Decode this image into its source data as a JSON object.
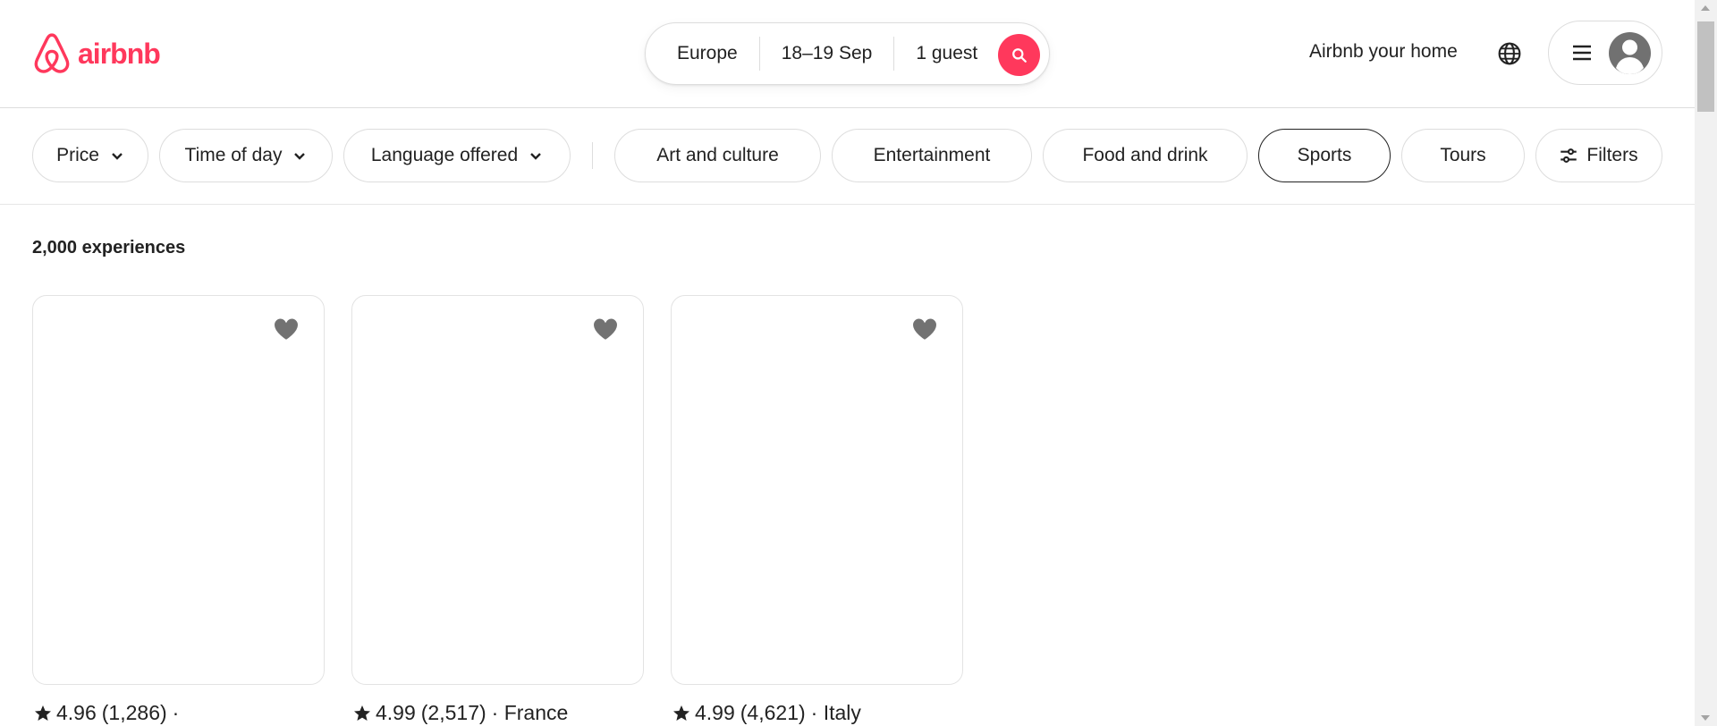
{
  "brand": {
    "name": "airbnb",
    "color": "#ff385c"
  },
  "search": {
    "location": "Europe",
    "dates": "18–19 Sep",
    "guests": "1 guest",
    "button_icon": "search-icon"
  },
  "nav": {
    "host_link": "Airbnb your home",
    "globe_icon": "globe-icon",
    "menu_icon": "hamburger-menu-icon",
    "avatar_icon": "user-avatar-icon"
  },
  "filters": {
    "dropdowns": [
      "Price",
      "Time of day",
      "Language offered"
    ],
    "categories": [
      "Art and culture",
      "Entertainment",
      "Food and drink",
      "Sports",
      "Tours"
    ],
    "selected_category": "Sports",
    "filters_button": "Filters"
  },
  "results": {
    "count_label": "2,000 experiences",
    "cards": [
      {
        "rating": "4.96",
        "reviews": "(1,286)",
        "location": "·"
      },
      {
        "rating": "4.99",
        "reviews": "(2,517)",
        "location": "· France"
      },
      {
        "rating": "4.99",
        "reviews": "(4,621)",
        "location": "· Italy"
      }
    ]
  }
}
